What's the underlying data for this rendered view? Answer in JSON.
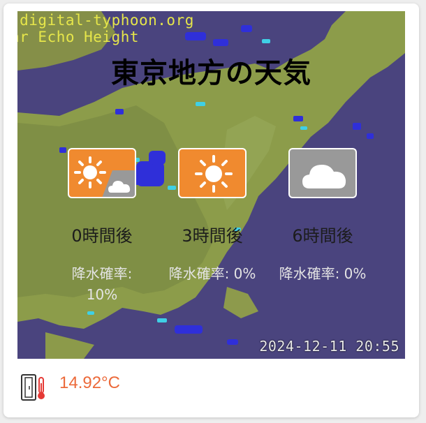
{
  "map": {
    "watermark_line1": ".digital-typhoon.org",
    "watermark_line2": "ar Echo Height",
    "timestamp": "2024-12-11 20:55"
  },
  "title": "東京地方の天気",
  "forecasts": [
    {
      "icon": "sun-cloud-icon",
      "time": "0時間後",
      "precip": "降水確率: 10%"
    },
    {
      "icon": "sun-icon",
      "time": "3時間後",
      "precip": "降水確率: 0%"
    },
    {
      "icon": "cloud-icon",
      "time": "6時間後",
      "precip": "降水確率: 0%"
    }
  ],
  "footer": {
    "sensor_icon": "door-thermometer-icon",
    "temperature": "14.92°C"
  },
  "colors": {
    "sun_bg": "#f08a2f",
    "cloud_bg": "#999999",
    "temperature": "#ec6a3a",
    "sea": "#4a447e"
  }
}
